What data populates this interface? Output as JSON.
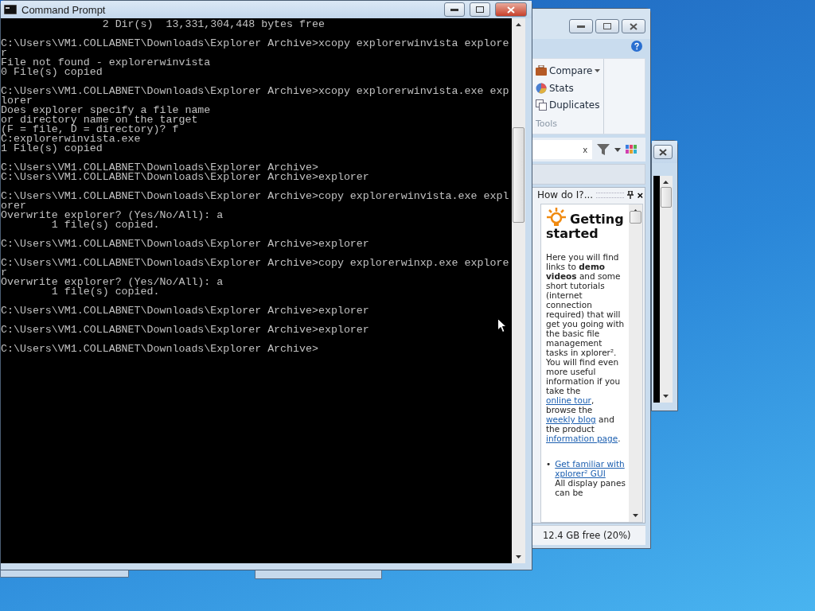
{
  "console_window": {
    "title": "Command Prompt",
    "blocks": [
      [
        "                2 Dir(s)  13,331,304,448 bytes free"
      ],
      [
        "C:\\Users\\VM1.COLLABNET\\Downloads\\Explorer Archive>xcopy explorerwinvista explore",
        "r",
        "File not found - explorerwinvista",
        "0 File(s) copied"
      ],
      [
        "C:\\Users\\VM1.COLLABNET\\Downloads\\Explorer Archive>xcopy explorerwinvista.exe exp",
        "lorer",
        "Does explorer specify a file name",
        "or directory name on the target",
        "(F = file, D = directory)? f",
        "C:explorerwinvista.exe",
        "1 File(s) copied"
      ],
      [
        "C:\\Users\\VM1.COLLABNET\\Downloads\\Explorer Archive>",
        "C:\\Users\\VM1.COLLABNET\\Downloads\\Explorer Archive>explorer"
      ],
      [
        "C:\\Users\\VM1.COLLABNET\\Downloads\\Explorer Archive>copy explorerwinvista.exe expl",
        "orer",
        "Overwrite explorer? (Yes/No/All): a",
        "        1 file(s) copied."
      ],
      [
        "C:\\Users\\VM1.COLLABNET\\Downloads\\Explorer Archive>explorer"
      ],
      [
        "C:\\Users\\VM1.COLLABNET\\Downloads\\Explorer Archive>copy explorerwinxp.exe explore",
        "r",
        "Overwrite explorer? (Yes/No/All): a",
        "        1 file(s) copied."
      ],
      [
        "C:\\Users\\VM1.COLLABNET\\Downloads\\Explorer Archive>explorer"
      ],
      [
        "C:\\Users\\VM1.COLLABNET\\Downloads\\Explorer Archive>explorer"
      ],
      [
        "C:\\Users\\VM1.COLLABNET\\Downloads\\Explorer Archive>"
      ]
    ]
  },
  "file_manager": {
    "ribbon": {
      "items": [
        {
          "kind": "compare",
          "label": "Compare",
          "dropdown": true
        },
        {
          "kind": "stats",
          "label": "Stats",
          "dropdown": false
        },
        {
          "kind": "duplicates",
          "label": "Duplicates",
          "dropdown": false
        }
      ],
      "group_label": "Tools"
    },
    "search": {
      "clear": "x"
    },
    "help_pane": {
      "title": "How do I?...",
      "close": "×",
      "heading": "Getting started",
      "paragraph": [
        {
          "kind": "text",
          "text": "Here you will find links to **demo videos** and some short tutorials (internet connection required) that will get you going with the basic file management tasks in xplorer². You will find even more useful information if you take the "
        },
        {
          "kind": "link",
          "text": "online tour"
        },
        {
          "kind": "text",
          "text": ", browse the "
        },
        {
          "kind": "link",
          "text": "weekly blog"
        },
        {
          "kind": "text",
          "text": " and the product "
        },
        {
          "kind": "link",
          "text": "information page"
        },
        {
          "kind": "text",
          "text": "."
        }
      ],
      "bullets": [
        {
          "marker": "•",
          "link": "Get familiar with xplorer² GUI",
          "text": "All display panes can be"
        }
      ]
    },
    "status_bar": "12.4 GB free (20%)"
  }
}
